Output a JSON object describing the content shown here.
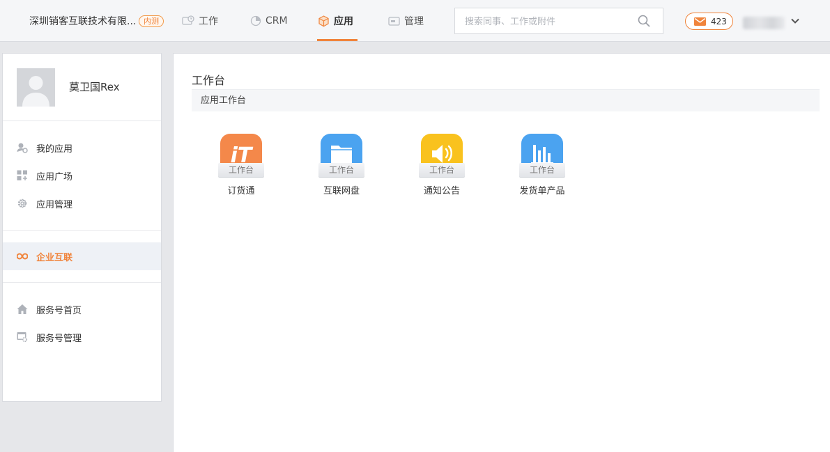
{
  "header": {
    "company": "深圳销客互联技术有限...",
    "company_badge": "内测",
    "nav": [
      {
        "label": "工作",
        "icon": "work-icon"
      },
      {
        "label": "CRM",
        "icon": "crm-pie-icon"
      },
      {
        "label": "应用",
        "icon": "app-cube-icon",
        "active": true
      },
      {
        "label": "管理",
        "icon": "admin-icon"
      }
    ],
    "search_placeholder": "搜索同事、工作或附件",
    "mail_count": "423",
    "accent_color": "#f0843c"
  },
  "sidebar": {
    "user_name": "莫卫国Rex",
    "groups": [
      [
        {
          "label": "我的应用",
          "icon": "my-apps-icon"
        },
        {
          "label": "应用广场",
          "icon": "app-square-icon"
        },
        {
          "label": "应用管理",
          "icon": "gear-icon"
        }
      ],
      [
        {
          "label": "企业互联",
          "icon": "link-icon",
          "active": true
        }
      ],
      [
        {
          "label": "服务号首页",
          "icon": "home-icon"
        },
        {
          "label": "服务号管理",
          "icon": "service-manage-icon"
        }
      ]
    ]
  },
  "main": {
    "title": "工作台",
    "section": "应用工作台",
    "apps": [
      {
        "name": "订货通",
        "tag": "工作台",
        "icon": "it-logo-icon",
        "color": "#f4884a"
      },
      {
        "name": "互联网盘",
        "tag": "工作台",
        "icon": "folder-icon",
        "color": "#4ba3f0"
      },
      {
        "name": "通知公告",
        "tag": "工作台",
        "icon": "speaker-icon",
        "color": "#f9c21e"
      },
      {
        "name": "发货单产品",
        "tag": "工作台",
        "icon": "bar-chart-icon",
        "color": "#4ba3f0"
      }
    ]
  }
}
